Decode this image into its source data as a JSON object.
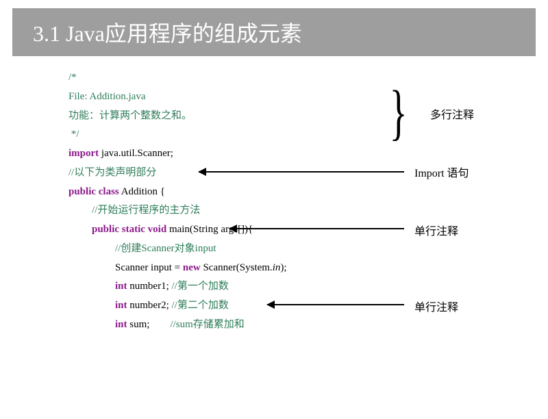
{
  "title": "3.1 Java应用程序的组成元素",
  "code": {
    "l1": "/*",
    "l2": "File: Addition.java",
    "l3": "功能：计算两个整数之和。",
    "l4": " */",
    "l5a": "import",
    "l5b": " java.util.Scanner;",
    "l6": "//以下为类声明部分",
    "l7a": "public class",
    "l7b": " Addition {",
    "l8": "//开始运行程序的主方法",
    "l9a": "public static void",
    "l9b": " main(String args[]){",
    "l10": "//创建Scanner对象input",
    "l11a": "Scanner input = ",
    "l11b": "new",
    "l11c": " Scanner(System.",
    "l11d": "in",
    "l11e": ");",
    "l12a": "int",
    "l12b": " number1; ",
    "l12c": "//第一个加数",
    "l13a": "int",
    "l13b": " number2; ",
    "l13c": "//第二个加数",
    "l14a": "int",
    "l14b": " sum;        ",
    "l14c": "//sum存储累加和"
  },
  "annotations": {
    "multi_comment": "多行注释",
    "import_stmt": "Import 语句",
    "single_comment1": "单行注释",
    "single_comment2": "单行注释"
  }
}
